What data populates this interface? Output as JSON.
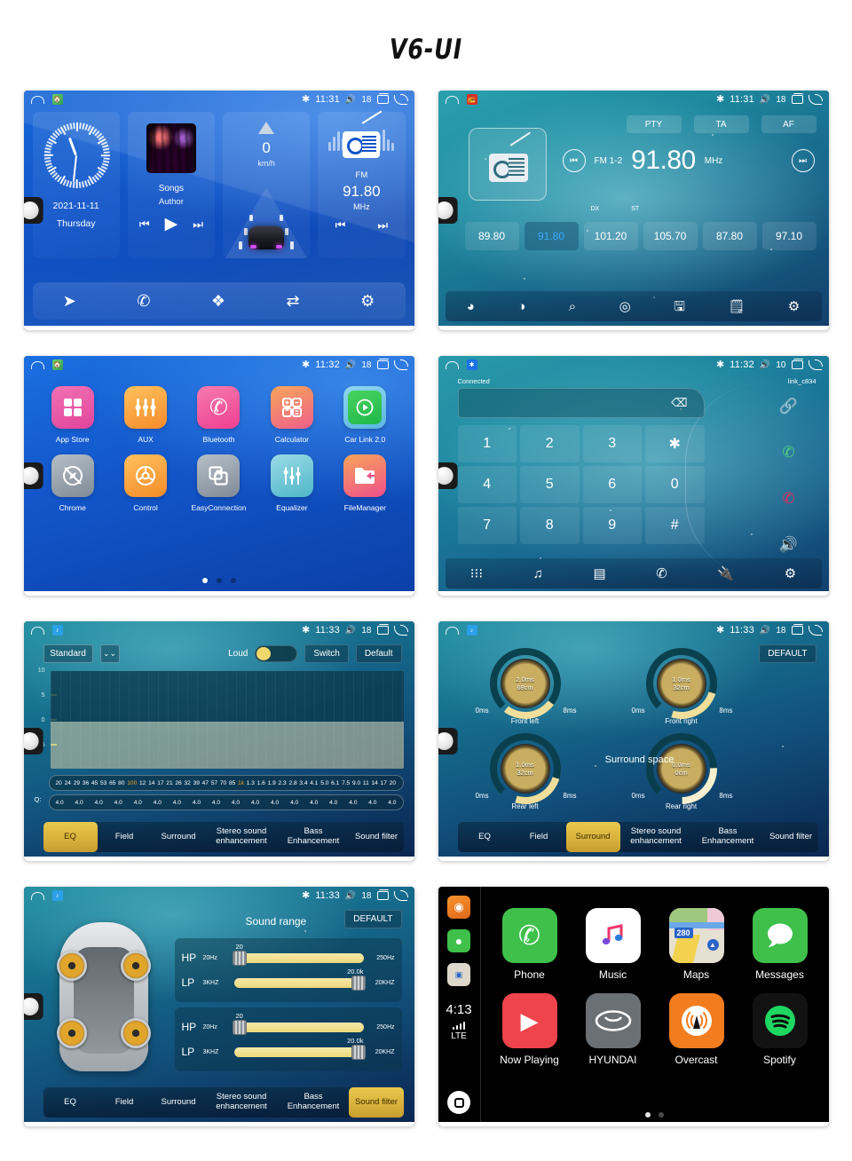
{
  "title": "V6-UI",
  "statusbar": {
    "time_1131": "11:31",
    "time_1132": "11:32",
    "time_1133": "11:33",
    "vol_18": "18",
    "vol_10": "10",
    "bt_icon": "bluetooth-icon",
    "vol_icon": "volume-icon",
    "recent_icon": "recent-apps-icon",
    "back_icon": "back-icon",
    "home_icon": "home-icon"
  },
  "home": {
    "clock": {
      "date": "2021-11-11",
      "day": "Thursday"
    },
    "music": {
      "title": "Songs",
      "artist": "Author",
      "prev": "⏮",
      "play": "▶",
      "next": "⏭"
    },
    "nav": {
      "speed": "0",
      "unit": "km/h"
    },
    "radio": {
      "band": "FM",
      "freq": "91.80",
      "unit": "MHz",
      "prev": "⏮",
      "next": "⏭"
    },
    "dock": [
      {
        "name": "navigation-icon",
        "glyph": "➤"
      },
      {
        "name": "phone-icon",
        "glyph": "✆"
      },
      {
        "name": "apps-icon",
        "glyph": "❖"
      },
      {
        "name": "carlink-icon",
        "glyph": "⇄"
      },
      {
        "name": "settings-icon",
        "glyph": "⚙"
      }
    ]
  },
  "radio": {
    "buttons": [
      "PTY",
      "TA",
      "AF"
    ],
    "band": "FM 1-2",
    "freq": "91.80",
    "unit": "MHz",
    "prev": "⏮",
    "next": "⏭",
    "dx": "DX",
    "st": "ST",
    "presets": [
      {
        "freq": "89.80",
        "active": false
      },
      {
        "freq": "91.80",
        "active": true
      },
      {
        "freq": "101.20",
        "active": false
      },
      {
        "freq": "105.70",
        "active": false
      },
      {
        "freq": "87.80",
        "active": false
      },
      {
        "freq": "97.10",
        "active": false
      }
    ],
    "dock": [
      {
        "name": "band-icon",
        "glyph": "◔"
      },
      {
        "name": "stereo-toggle-icon",
        "glyph": "◍"
      },
      {
        "name": "search-icon",
        "glyph": "⌕"
      },
      {
        "name": "rds-icon",
        "glyph": "◎"
      },
      {
        "name": "save-icon",
        "glyph": "ὋE"
      },
      {
        "name": "edit-icon",
        "glyph": "✎"
      },
      {
        "name": "settings-icon",
        "glyph": "⚙"
      }
    ]
  },
  "apps": {
    "items": [
      {
        "label": "App Store",
        "icon": "grid-icon",
        "glyph": "❖",
        "color1": "#f05fa8",
        "color2": "#e0449a"
      },
      {
        "label": "AUX",
        "icon": "sliders-icon",
        "glyph": "⫶",
        "color1": "#ffb347",
        "color2": "#f58b29"
      },
      {
        "label": "Bluetooth",
        "icon": "phone-icon",
        "glyph": "✆",
        "color1": "#f25ba0",
        "color2": "#ef3f8f"
      },
      {
        "label": "Calculator",
        "icon": "calculator-icon",
        "glyph": "⊞",
        "color1": "#f7985a",
        "color2": "#ef5f8a"
      },
      {
        "label": "Car Link 2.0",
        "icon": "play-icon",
        "glyph": "▶",
        "color1": "#38d15a",
        "color2": "#1fb84a"
      },
      {
        "label": "Chrome",
        "icon": "compass-icon",
        "glyph": "✦",
        "color1": "#a9b3bd",
        "color2": "#7f8a96"
      },
      {
        "label": "Control",
        "icon": "steering-wheel-icon",
        "glyph": "◎",
        "color1": "#ffb347",
        "color2": "#f58b29"
      },
      {
        "label": "EasyConnection",
        "icon": "screen-mirror-icon",
        "glyph": "⧉",
        "color1": "#a9b3bd",
        "color2": "#7f8a96"
      },
      {
        "label": "Equalizer",
        "icon": "equalizer-icon",
        "glyph": "⫶",
        "color1": "#7fd3e0",
        "color2": "#4fb6c9"
      },
      {
        "label": "FileManager",
        "icon": "folder-icon",
        "glyph": "Ὄ1",
        "color1": "#f7985a",
        "color2": "#ef4f8a"
      }
    ],
    "page_dots": [
      true,
      false,
      false
    ]
  },
  "phone": {
    "connected": "Connected",
    "device": "link_c834",
    "input_value": "",
    "backspace_icon": "backspace-icon",
    "keys": [
      "1",
      "2",
      "3",
      "✱",
      "4",
      "5",
      "6",
      "0",
      "7",
      "8",
      "9",
      "#"
    ],
    "side": [
      {
        "name": "link-icon",
        "glyph": "ὑ7"
      },
      {
        "name": "call-answer-icon",
        "glyph": "✆"
      },
      {
        "name": "call-end-icon",
        "glyph": "✆"
      },
      {
        "name": "speaker-icon",
        "glyph": "ὐA"
      }
    ],
    "dock": [
      {
        "name": "dialpad-icon",
        "glyph": "∷"
      },
      {
        "name": "music-icon",
        "glyph": "♫"
      },
      {
        "name": "contacts-icon",
        "glyph": "Ὄ7"
      },
      {
        "name": "call-history-icon",
        "glyph": "✆"
      },
      {
        "name": "bluetooth-pair-icon",
        "glyph": "ὐC"
      },
      {
        "name": "settings-icon",
        "glyph": "⚙"
      }
    ]
  },
  "eq": {
    "preset": "Standard",
    "dropdown_icon": "chevron-down-icon",
    "loud_label": "Loud",
    "loud_on": true,
    "switch_label": "Switch",
    "default_label": "Default",
    "q_label": "Q:",
    "y_axis": [
      "10",
      "5",
      "0",
      "-5"
    ],
    "frequencies": [
      "20",
      "24",
      "29",
      "36",
      "45",
      "53",
      "65",
      "80",
      "100",
      "12",
      "14",
      "17",
      "21",
      "26",
      "32",
      "39",
      "47",
      "57",
      "70",
      "85",
      "1k",
      "1.3",
      "1.6",
      "1.9",
      "2.3",
      "2.8",
      "3.4",
      "4.1",
      "5.0",
      "6.1",
      "7.5",
      "9.0",
      "11",
      "14",
      "17",
      "20"
    ],
    "highlight_freqs": [
      "100",
      "1k"
    ],
    "q_values": [
      "4.0",
      "4.0",
      "4.0",
      "4.0",
      "4.0",
      "4.0",
      "4.0",
      "4.0",
      "4.0",
      "4.0",
      "4.0",
      "4.0",
      "4.0",
      "4.0",
      "4.0",
      "4.0",
      "4.0",
      "4.0"
    ]
  },
  "audio_tabs": {
    "items": [
      "EQ",
      "Field",
      "Surround",
      "Stereo sound enhancement",
      "Bass Enhancement",
      "Sound filter"
    ]
  },
  "surround": {
    "default_label": "DEFAULT",
    "title": "Surround space",
    "knobs": [
      {
        "label": "Front left",
        "ms": "2.0ms",
        "cm": "68cm",
        "min": "0ms",
        "max": "8ms",
        "angle": -92
      },
      {
        "label": "Front right",
        "ms": "1.0ms",
        "cm": "32cm",
        "min": "0ms",
        "max": "8ms",
        "angle": -112
      },
      {
        "label": "Rear left",
        "ms": "1.0ms",
        "cm": "32cm",
        "min": "0ms",
        "max": "8ms",
        "angle": -112
      },
      {
        "label": "Rear right",
        "ms": "0.0ms",
        "cm": "0cm",
        "min": "0ms",
        "max": "8ms",
        "angle": -130
      }
    ]
  },
  "sound_filter": {
    "title": "Sound range",
    "default_label": "DEFAULT",
    "groups": [
      {
        "rows": [
          {
            "tag": "HP",
            "low": "20Hz",
            "high": "250Hz",
            "value": "20",
            "pos": "left"
          },
          {
            "tag": "LP",
            "low": "3KHZ",
            "high": "20KHZ",
            "value": "20.0k",
            "pos": "right"
          }
        ]
      },
      {
        "rows": [
          {
            "tag": "HP",
            "low": "20Hz",
            "high": "250Hz",
            "value": "20",
            "pos": "left"
          },
          {
            "tag": "LP",
            "low": "3KHZ",
            "high": "20KHZ",
            "value": "20.0k",
            "pos": "right"
          }
        ]
      }
    ]
  },
  "carplay": {
    "time": "4:13",
    "network": "LTE",
    "rail": [
      {
        "name": "overcast-mini-icon",
        "color": "#f27c1e"
      },
      {
        "name": "messages-mini-icon",
        "color": "#3fc04b"
      },
      {
        "name": "maps-mini-icon",
        "color": "#d8d3c6"
      }
    ],
    "apps": [
      {
        "label": "Phone",
        "icon": "phone-icon",
        "glyph": "✆",
        "bg": "#3fc04b",
        "fg": "#ffffff"
      },
      {
        "label": "Music",
        "icon": "music-note-icon",
        "glyph": "♫",
        "bg": "#ffffff",
        "fg": "#f0356b"
      },
      {
        "label": "Maps",
        "icon": "map-icon",
        "glyph": "280",
        "bg": "#e3ddd0",
        "fg": "#2a63c8"
      },
      {
        "label": "Messages",
        "icon": "speech-bubble-icon",
        "glyph": "●",
        "bg": "#3fc04b",
        "fg": "#ffffff"
      },
      {
        "label": "Now Playing",
        "icon": "play-triangle-icon",
        "glyph": "▶",
        "bg": "#f0444c",
        "fg": "#ffffff"
      },
      {
        "label": "HYUNDAI",
        "icon": "hyundai-logo-icon",
        "glyph": "Ⓗ",
        "bg": "#6b7075",
        "fg": "#ffffff"
      },
      {
        "label": "Overcast",
        "icon": "radio-tower-icon",
        "glyph": "὎1",
        "bg": "#f27c1e",
        "fg": "#ffffff"
      },
      {
        "label": "Spotify",
        "icon": "spotify-icon",
        "glyph": "◉",
        "bg": "#111111",
        "fg": "#1ed760"
      }
    ],
    "page_dots": [
      true,
      false
    ]
  }
}
